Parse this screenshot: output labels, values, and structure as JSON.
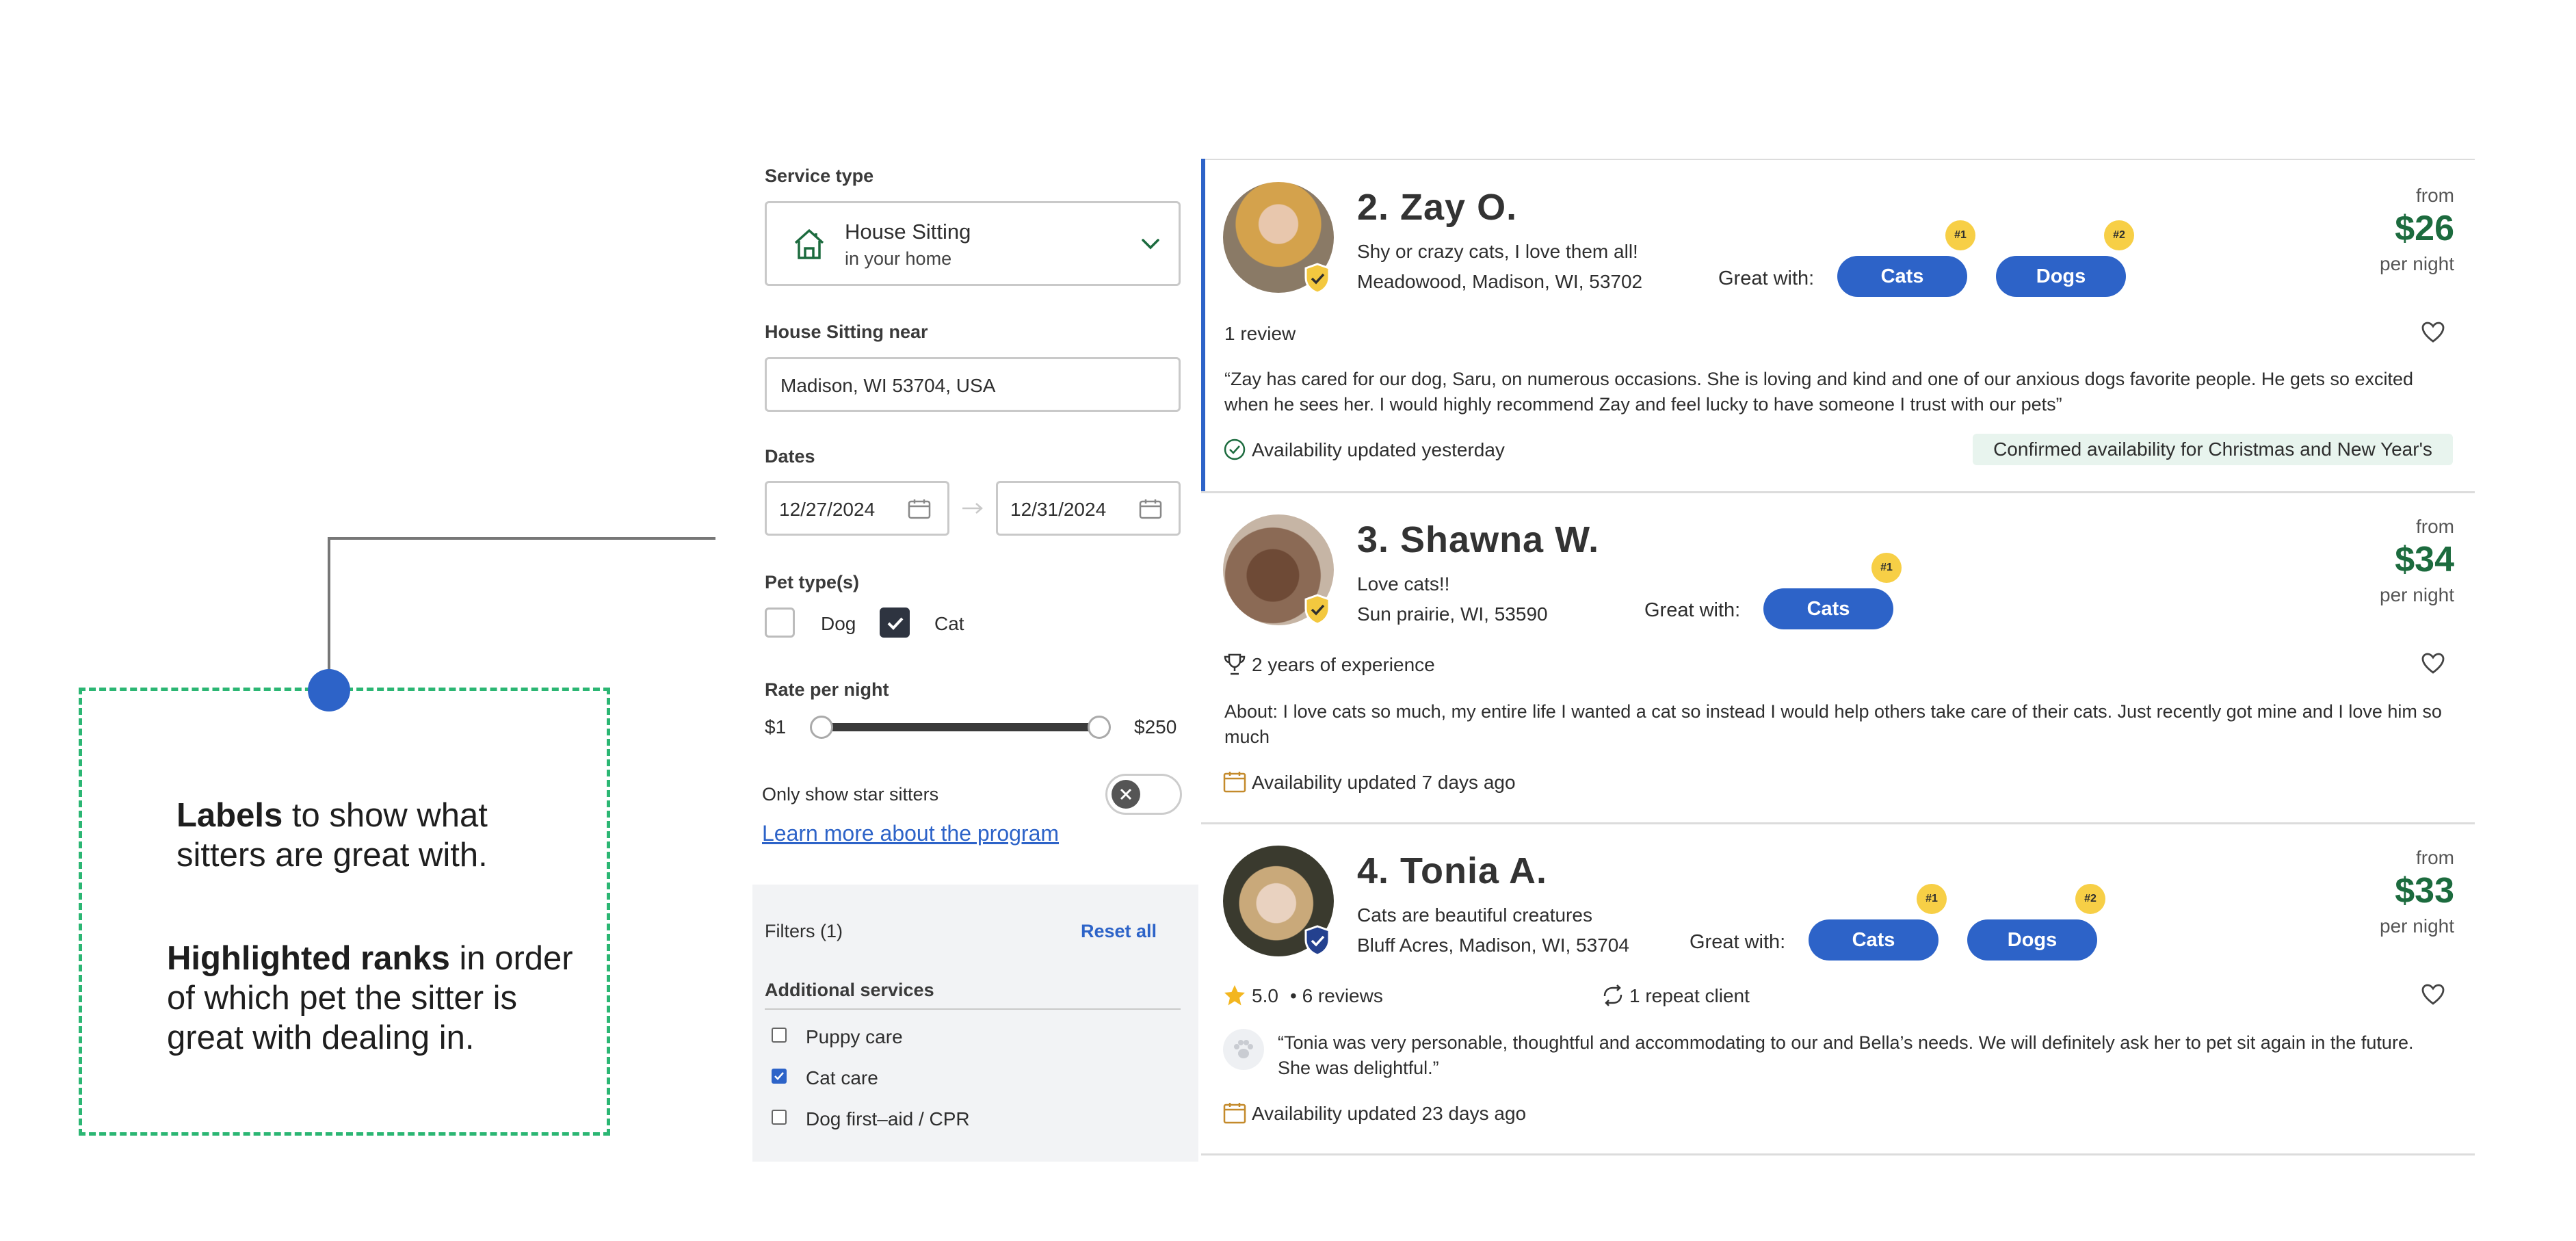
{
  "annotation": {
    "labels_bold": "Labels",
    "labels_rest_line1": " to show what",
    "labels_rest_line2": "sitters are great with.",
    "ranks_bold": "Highlighted ranks",
    "ranks_rest_line1": " in order",
    "ranks_rest_line2": "of which pet the sitter is",
    "ranks_rest_line3": "great with dealing in."
  },
  "sidebar": {
    "service_type_label": "Service type",
    "service_type_value": "House Sitting",
    "service_type_sub": "in your home",
    "near_label": "House Sitting near",
    "near_value": "Madison, WI 53704, USA",
    "dates_label": "Dates",
    "date_start": "12/27/2024",
    "date_end": "12/31/2024",
    "pet_types_label": "Pet type(s)",
    "pet_dog": "Dog",
    "pet_cat": "Cat",
    "pet_dog_checked": false,
    "pet_cat_checked": true,
    "rate_label": "Rate per night",
    "rate_min": "$1",
    "rate_max": "$250",
    "star_label": "Only show star sitters",
    "learn_more": "Learn more about the program",
    "filters_label": "Filters (1)",
    "reset_all": "Reset all",
    "additional_services": "Additional services",
    "services": [
      {
        "label": "Puppy care",
        "checked": false
      },
      {
        "label": "Cat care",
        "checked": true
      },
      {
        "label": "Dog first–aid / CPR",
        "checked": false
      }
    ]
  },
  "sitters": [
    {
      "name": "2. Zay O.",
      "tagline": "Shy or crazy cats, I love them all!",
      "location": "Meadowood, Madison, WI, 53702",
      "great_with_label": "Great with:",
      "tags": [
        {
          "label": "Cats",
          "rank": "#1"
        },
        {
          "label": "Dogs",
          "rank": "#2"
        }
      ],
      "from": "from",
      "price": "$26",
      "per_night": "per night",
      "meta": "1 review",
      "review": "“Zay has cared for our dog, Saru, on numerous occasions. She is loving and kind and one of our anxious dogs favorite people. He gets so excited when he sees her. I would highly recommend Zay and feel lucky to have someone I trust with our pets”",
      "availability": "Availability updated yesterday",
      "holiday_badge": "Confirmed availability for Christmas and New Year's"
    },
    {
      "name": "3. Shawna W.",
      "tagline": "Love cats!!",
      "location": "Sun prairie, WI, 53590",
      "great_with_label": "Great with:",
      "tags": [
        {
          "label": "Cats",
          "rank": "#1"
        }
      ],
      "from": "from",
      "price": "$34",
      "per_night": "per night",
      "meta": "2 years of experience",
      "review": "About: I love cats so much, my entire life I wanted a cat so instead I would help others take care of their cats. Just recently got mine and I love him so much",
      "availability": "Availability updated 7 days ago"
    },
    {
      "name": "4. Tonia A.",
      "tagline": "Cats are beautiful creatures",
      "location": "Bluff Acres, Madison, WI, 53704",
      "great_with_label": "Great with:",
      "tags": [
        {
          "label": "Cats",
          "rank": "#1"
        },
        {
          "label": "Dogs",
          "rank": "#2"
        }
      ],
      "from": "from",
      "price": "$33",
      "per_night": "per night",
      "rating": "5.0",
      "meta": "• 6 reviews",
      "repeat": "1 repeat client",
      "review": "“Tonia was very personable, thoughtful and accommodating to our and Bella’s needs. We will definitely ask her to pet sit again in the future. She was delightful.”",
      "availability": "Availability updated 23 days ago"
    }
  ],
  "colors": {
    "accent": "#2d63c8",
    "price_green": "#1c6b3e",
    "rank_yellow": "#f7cf46",
    "annotation_green": "#2bb673"
  }
}
